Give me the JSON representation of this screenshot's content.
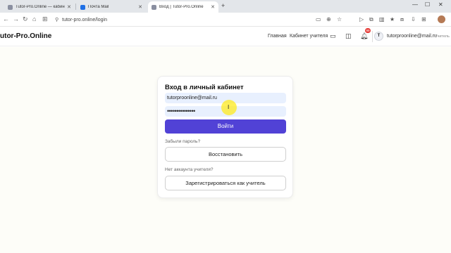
{
  "browser": {
    "tabs": [
      {
        "title": "Tutor-Pro.Online — кабинет р...",
        "active": false,
        "favicon_color": "#8a8fa0"
      },
      {
        "title": "Почта Mail",
        "active": false,
        "favicon_color": "#1f6fe5"
      },
      {
        "title": "Вход | Tutor-Pro.Online",
        "active": true,
        "favicon_color": "#8a8fa0"
      }
    ],
    "new_tab": "+",
    "address": "tutor-pro.online/login"
  },
  "header": {
    "brand": "utor-Pro.Online",
    "nav": [
      "Главная",
      "Кабинет учителя"
    ],
    "notification_count": "99",
    "avatar_letter": "T",
    "user_email": "tutorproonline@mail.ru",
    "user_role": "Учитель"
  },
  "login": {
    "title": "Вход в личный кабинет",
    "email_value": "tutorproonline@mail.ru",
    "password_value": "•••••••••••••••",
    "submit_label": "Войти",
    "forgot_text": "Забыли пароль?",
    "restore_label": "Восстановить",
    "no_account_text": "Нет аккаунта учителя?",
    "register_label": "Зарегистрироваться как учитель"
  },
  "colors": {
    "primary": "#5142d6",
    "field_bg": "#e8f0fe",
    "badge": "#e53935"
  }
}
